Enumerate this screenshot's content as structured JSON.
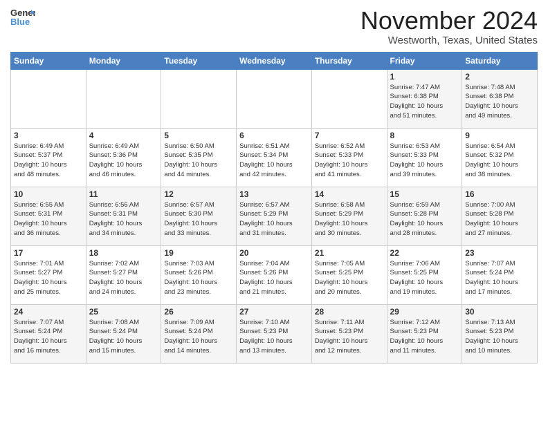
{
  "header": {
    "logo_line1": "General",
    "logo_line2": "Blue",
    "month": "November 2024",
    "location": "Westworth, Texas, United States"
  },
  "weekdays": [
    "Sunday",
    "Monday",
    "Tuesday",
    "Wednesday",
    "Thursday",
    "Friday",
    "Saturday"
  ],
  "weeks": [
    [
      {
        "day": "",
        "info": ""
      },
      {
        "day": "",
        "info": ""
      },
      {
        "day": "",
        "info": ""
      },
      {
        "day": "",
        "info": ""
      },
      {
        "day": "",
        "info": ""
      },
      {
        "day": "1",
        "info": "Sunrise: 7:47 AM\nSunset: 6:38 PM\nDaylight: 10 hours\nand 51 minutes."
      },
      {
        "day": "2",
        "info": "Sunrise: 7:48 AM\nSunset: 6:38 PM\nDaylight: 10 hours\nand 49 minutes."
      }
    ],
    [
      {
        "day": "3",
        "info": "Sunrise: 6:49 AM\nSunset: 5:37 PM\nDaylight: 10 hours\nand 48 minutes."
      },
      {
        "day": "4",
        "info": "Sunrise: 6:49 AM\nSunset: 5:36 PM\nDaylight: 10 hours\nand 46 minutes."
      },
      {
        "day": "5",
        "info": "Sunrise: 6:50 AM\nSunset: 5:35 PM\nDaylight: 10 hours\nand 44 minutes."
      },
      {
        "day": "6",
        "info": "Sunrise: 6:51 AM\nSunset: 5:34 PM\nDaylight: 10 hours\nand 42 minutes."
      },
      {
        "day": "7",
        "info": "Sunrise: 6:52 AM\nSunset: 5:33 PM\nDaylight: 10 hours\nand 41 minutes."
      },
      {
        "day": "8",
        "info": "Sunrise: 6:53 AM\nSunset: 5:33 PM\nDaylight: 10 hours\nand 39 minutes."
      },
      {
        "day": "9",
        "info": "Sunrise: 6:54 AM\nSunset: 5:32 PM\nDaylight: 10 hours\nand 38 minutes."
      }
    ],
    [
      {
        "day": "10",
        "info": "Sunrise: 6:55 AM\nSunset: 5:31 PM\nDaylight: 10 hours\nand 36 minutes."
      },
      {
        "day": "11",
        "info": "Sunrise: 6:56 AM\nSunset: 5:31 PM\nDaylight: 10 hours\nand 34 minutes."
      },
      {
        "day": "12",
        "info": "Sunrise: 6:57 AM\nSunset: 5:30 PM\nDaylight: 10 hours\nand 33 minutes."
      },
      {
        "day": "13",
        "info": "Sunrise: 6:57 AM\nSunset: 5:29 PM\nDaylight: 10 hours\nand 31 minutes."
      },
      {
        "day": "14",
        "info": "Sunrise: 6:58 AM\nSunset: 5:29 PM\nDaylight: 10 hours\nand 30 minutes."
      },
      {
        "day": "15",
        "info": "Sunrise: 6:59 AM\nSunset: 5:28 PM\nDaylight: 10 hours\nand 28 minutes."
      },
      {
        "day": "16",
        "info": "Sunrise: 7:00 AM\nSunset: 5:28 PM\nDaylight: 10 hours\nand 27 minutes."
      }
    ],
    [
      {
        "day": "17",
        "info": "Sunrise: 7:01 AM\nSunset: 5:27 PM\nDaylight: 10 hours\nand 25 minutes."
      },
      {
        "day": "18",
        "info": "Sunrise: 7:02 AM\nSunset: 5:27 PM\nDaylight: 10 hours\nand 24 minutes."
      },
      {
        "day": "19",
        "info": "Sunrise: 7:03 AM\nSunset: 5:26 PM\nDaylight: 10 hours\nand 23 minutes."
      },
      {
        "day": "20",
        "info": "Sunrise: 7:04 AM\nSunset: 5:26 PM\nDaylight: 10 hours\nand 21 minutes."
      },
      {
        "day": "21",
        "info": "Sunrise: 7:05 AM\nSunset: 5:25 PM\nDaylight: 10 hours\nand 20 minutes."
      },
      {
        "day": "22",
        "info": "Sunrise: 7:06 AM\nSunset: 5:25 PM\nDaylight: 10 hours\nand 19 minutes."
      },
      {
        "day": "23",
        "info": "Sunrise: 7:07 AM\nSunset: 5:24 PM\nDaylight: 10 hours\nand 17 minutes."
      }
    ],
    [
      {
        "day": "24",
        "info": "Sunrise: 7:07 AM\nSunset: 5:24 PM\nDaylight: 10 hours\nand 16 minutes."
      },
      {
        "day": "25",
        "info": "Sunrise: 7:08 AM\nSunset: 5:24 PM\nDaylight: 10 hours\nand 15 minutes."
      },
      {
        "day": "26",
        "info": "Sunrise: 7:09 AM\nSunset: 5:24 PM\nDaylight: 10 hours\nand 14 minutes."
      },
      {
        "day": "27",
        "info": "Sunrise: 7:10 AM\nSunset: 5:23 PM\nDaylight: 10 hours\nand 13 minutes."
      },
      {
        "day": "28",
        "info": "Sunrise: 7:11 AM\nSunset: 5:23 PM\nDaylight: 10 hours\nand 12 minutes."
      },
      {
        "day": "29",
        "info": "Sunrise: 7:12 AM\nSunset: 5:23 PM\nDaylight: 10 hours\nand 11 minutes."
      },
      {
        "day": "30",
        "info": "Sunrise: 7:13 AM\nSunset: 5:23 PM\nDaylight: 10 hours\nand 10 minutes."
      }
    ]
  ]
}
